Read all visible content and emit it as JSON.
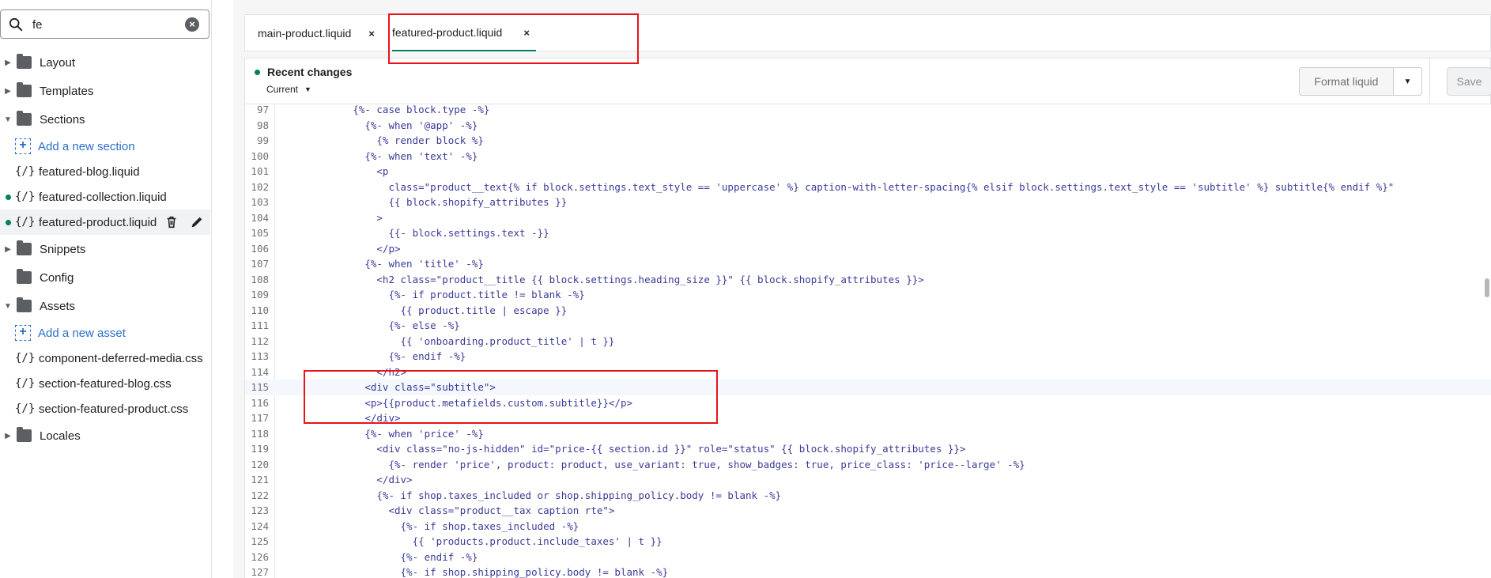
{
  "search": {
    "value": "fe"
  },
  "sidebar": {
    "folders": {
      "layout": "Layout",
      "templates": "Templates",
      "sections": "Sections",
      "snippets": "Snippets",
      "config": "Config",
      "assets": "Assets",
      "locales": "Locales"
    },
    "add_section": "Add a new section",
    "add_asset": "Add a new asset",
    "section_files": [
      "featured-blog.liquid",
      "featured-collection.liquid",
      "featured-product.liquid"
    ],
    "asset_files": [
      "component-deferred-media.css",
      "section-featured-blog.css",
      "section-featured-product.css"
    ],
    "file_icon_glyph": "{/}"
  },
  "tabs": [
    {
      "label": "main-product.liquid",
      "close": "×"
    },
    {
      "label": "featured-product.liquid",
      "close": "×"
    }
  ],
  "editor": {
    "recent_changes": "Recent changes",
    "version": "Current",
    "format_button": "Format liquid",
    "save_button": "Save"
  },
  "code": {
    "line_numbers": [
      "97",
      "98",
      "99",
      "100",
      "101",
      "102",
      "103",
      "104",
      "105",
      "106",
      "107",
      "108",
      "109",
      "110",
      "111",
      "112",
      "113",
      "114",
      "115",
      "116",
      "117",
      "118",
      "119",
      "120",
      "121",
      "122",
      "123",
      "124",
      "125",
      "126",
      "127"
    ],
    "lines": [
      "            {%- case block.type -%}",
      "              {%- when '@app' -%}",
      "                {% render block %}",
      "              {%- when 'text' -%}",
      "                <p",
      "                  class=\"product__text{% if block.settings.text_style == 'uppercase' %} caption-with-letter-spacing{% elsif block.settings.text_style == 'subtitle' %} subtitle{% endif %}\"",
      "                  {{ block.shopify_attributes }}",
      "                >",
      "                  {{- block.settings.text -}}",
      "                </p>",
      "              {%- when 'title' -%}",
      "                <h2 class=\"product__title {{ block.settings.heading_size }}\" {{ block.shopify_attributes }}>",
      "                  {%- if product.title != blank -%}",
      "                    {{ product.title | escape }}",
      "                  {%- else -%}",
      "                    {{ 'onboarding.product_title' | t }}",
      "                  {%- endif -%}",
      "                </h2>",
      "              <div class=\"subtitle\">",
      "              <p>{{product.metafields.custom.subtitle}}</p>",
      "              </div>",
      "              {%- when 'price' -%}",
      "                <div class=\"no-js-hidden\" id=\"price-{{ section.id }}\" role=\"status\" {{ block.shopify_attributes }}>",
      "                  {%- render 'price', product: product, use_variant: true, show_badges: true, price_class: 'price--large' -%}",
      "                </div>",
      "                {%- if shop.taxes_included or shop.shipping_policy.body != blank -%}",
      "                  <div class=\"product__tax caption rte\">",
      "                    {%- if shop.taxes_included -%}",
      "                      {{ 'products.product.include_taxes' | t }}",
      "                    {%- endif -%}",
      "                    {%- if shop.shipping_policy.body != blank -%}"
    ]
  }
}
